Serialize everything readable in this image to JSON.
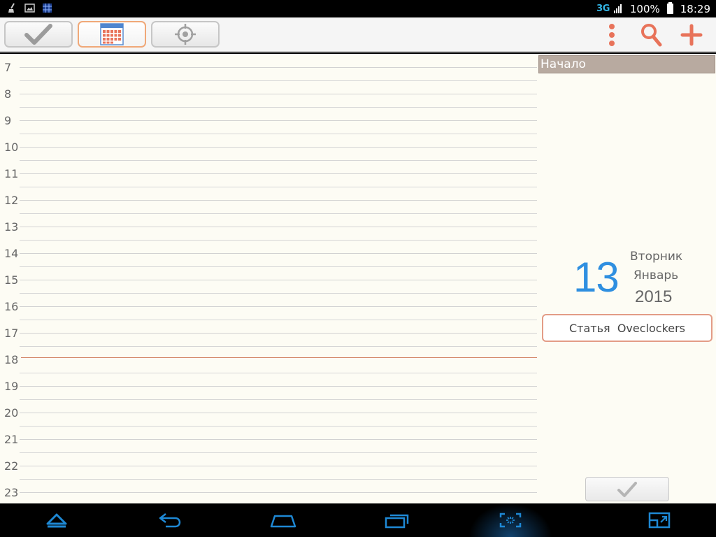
{
  "status_bar": {
    "icons": [
      "broom-icon",
      "image-icon",
      "network-grid-icon"
    ],
    "network_type": "3G",
    "battery_percent": "100%",
    "time": "18:29"
  },
  "toolbar": {
    "tabs": [
      {
        "name": "tasks-tab",
        "icon": "checkmark-icon"
      },
      {
        "name": "calendar-tab",
        "icon": "calendar-icon",
        "active": true
      },
      {
        "name": "location-tab",
        "icon": "target-icon"
      }
    ],
    "actions": [
      "overflow-menu-icon",
      "search-icon",
      "add-icon"
    ],
    "accent_color": "#e8735a"
  },
  "timeline": {
    "hours": [
      "7",
      "8",
      "9",
      "10",
      "11",
      "12",
      "13",
      "14",
      "15",
      "16",
      "17",
      "18",
      "19",
      "20",
      "21",
      "22",
      "23"
    ],
    "current_hour": "18",
    "now_line_color": "#d08060"
  },
  "panel": {
    "header": "Начало",
    "date": {
      "day": "13",
      "weekday": "Вторник",
      "month": "Январь",
      "year": "2015"
    },
    "event_label": "Статья  Oveclockers",
    "day_color": "#2f8fe0"
  },
  "nav_bar": {
    "buttons": [
      "hide-bar-icon",
      "back-icon",
      "home-icon",
      "recent-apps-icon",
      "screenshot-icon",
      "window-mode-icon"
    ],
    "icon_color": "#1e88d4"
  }
}
